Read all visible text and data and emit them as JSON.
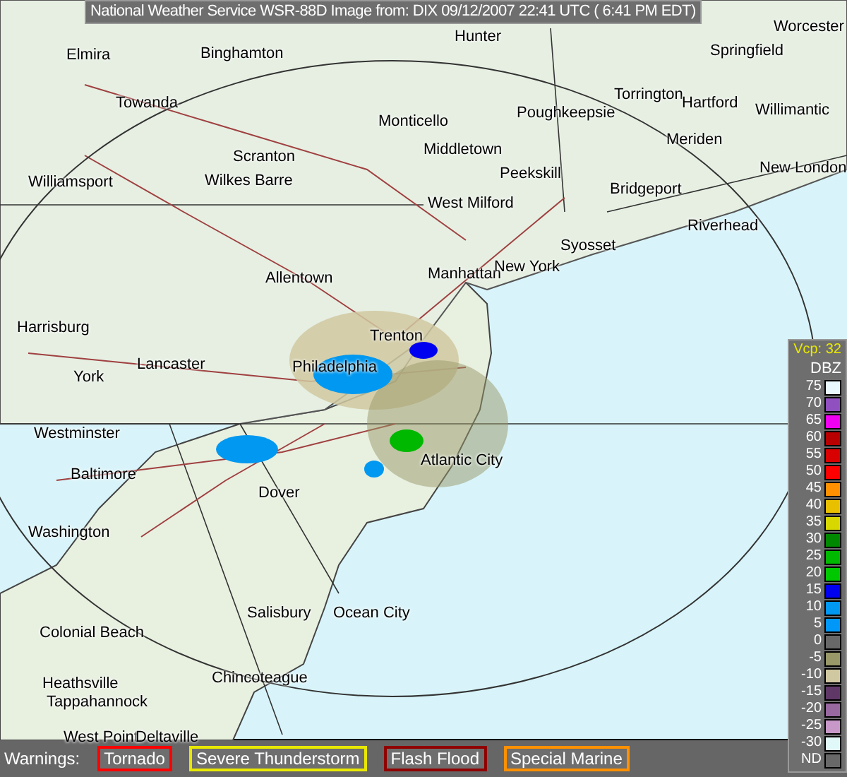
{
  "title": "National Weather Service WSR-88D Image from: DIX 09/12/2007 22:41 UTC ( 6:41 PM EDT)",
  "cities": [
    "Elmira",
    "Binghamton",
    "Hunter",
    "Worcester",
    "Springfield",
    "Towanda",
    "Monticello",
    "Poughkeepsie",
    "Torrington",
    "Hartford",
    "Willimantic",
    "Middletown",
    "Meriden",
    "Scranton",
    "Williamsport",
    "Wilkes Barre",
    "Peekskill",
    "Bridgeport",
    "New London",
    "West Milford",
    "Riverhead",
    "Syosset",
    "Manhattan",
    "New York",
    "Allentown",
    "Harrisburg",
    "Trenton",
    "Lancaster",
    "York",
    "Philadelphia",
    "Westminster",
    "Baltimore",
    "Atlantic City",
    "Dover",
    "Washington",
    "Salisbury",
    "Ocean City",
    "Colonial Beach",
    "Chincoteague",
    "Heathsville",
    "Tappahannock",
    "West Point",
    "Deltaville"
  ],
  "legend": {
    "vcp": "Vcp: 32",
    "unit": "DBZ",
    "levels": [
      {
        "label": "75",
        "color": "#e8f8fc"
      },
      {
        "label": "70",
        "color": "#9050c0"
      },
      {
        "label": "65",
        "color": "#f000f0"
      },
      {
        "label": "60",
        "color": "#b80000"
      },
      {
        "label": "55",
        "color": "#d80000"
      },
      {
        "label": "50",
        "color": "#ff0000"
      },
      {
        "label": "45",
        "color": "#ff9000"
      },
      {
        "label": "40",
        "color": "#e8c000"
      },
      {
        "label": "35",
        "color": "#d8d800"
      },
      {
        "label": "30",
        "color": "#008800"
      },
      {
        "label": "25",
        "color": "#00b800"
      },
      {
        "label": "20",
        "color": "#00c800"
      },
      {
        "label": "15",
        "color": "#0000f0"
      },
      {
        "label": "10",
        "color": "#0098f0"
      },
      {
        "label": "5",
        "color": "#0098f8"
      },
      {
        "label": "0",
        "color": "#686868"
      },
      {
        "label": "-5",
        "color": "#989868"
      },
      {
        "label": "-10",
        "color": "#d0c8a0"
      },
      {
        "label": "-15",
        "color": "#603868"
      },
      {
        "label": "-20",
        "color": "#9868a0"
      },
      {
        "label": "-25",
        "color": "#c898c8"
      },
      {
        "label": "-30",
        "color": "#e0f8f8"
      },
      {
        "label": "ND",
        "color": "#686868"
      }
    ]
  },
  "warnings": {
    "label": "Warnings:",
    "items": [
      {
        "label": "Tornado",
        "color": "#ff0000"
      },
      {
        "label": "Severe Thunderstorm",
        "color": "#e8e800"
      },
      {
        "label": "Flash Flood",
        "color": "#900000"
      },
      {
        "label": "Special Marine",
        "color": "#ff9000"
      }
    ]
  }
}
